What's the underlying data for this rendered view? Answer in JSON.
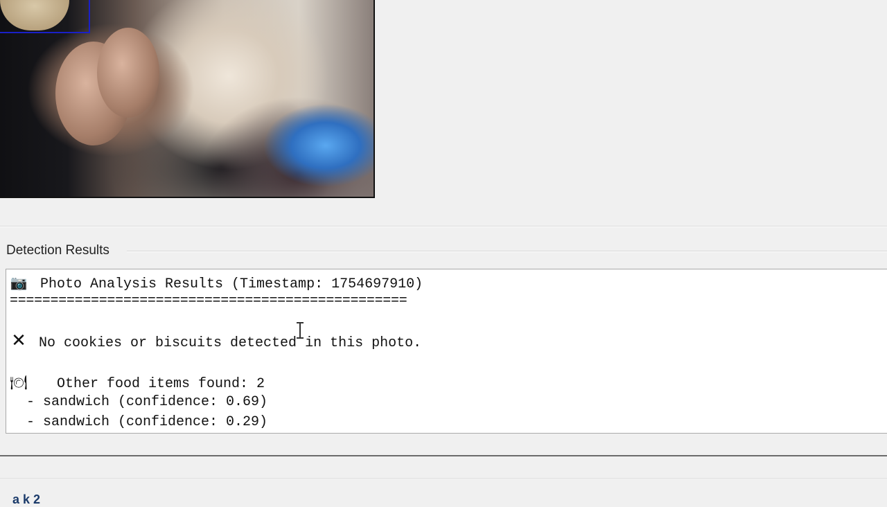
{
  "panel": {
    "title": "Detection Results"
  },
  "results": {
    "header_icon": "camera-icon",
    "header_text": "Photo Analysis Results (Timestamp: 1754697910)",
    "separator": "=================================================",
    "status_icon": "cross-icon",
    "status_text": "No cookies or biscuits detected in this photo.",
    "other_icon": "plate-icon",
    "other_text": "  Other food items found: 2",
    "items": [
      "  - sandwich (confidence: 0.69)",
      "  - sandwich (confidence: 0.29)"
    ]
  },
  "bottom_peek": "a k 2",
  "colors": {
    "detection_box": "#1a20c8",
    "window_bg": "#f0f0f0"
  }
}
